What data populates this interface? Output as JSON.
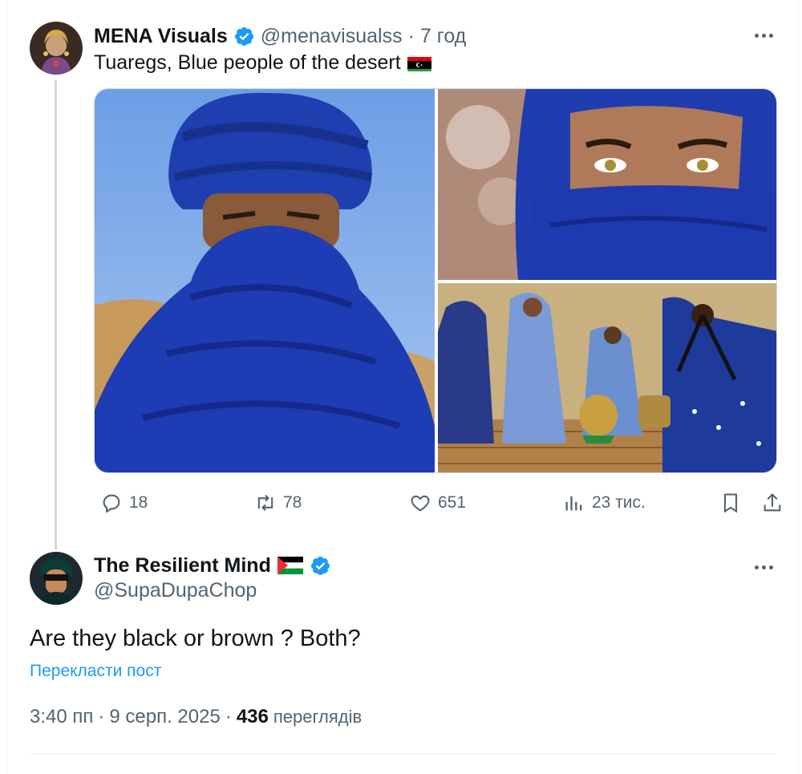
{
  "tweet1": {
    "name": "MENA Visuals",
    "handle": "@menavisualss",
    "dot": "·",
    "time": "7 год",
    "text": "Tuaregs, Blue people of the desert",
    "flag_icon": "libya-flag",
    "stats": {
      "replies": "18",
      "retweets": "78",
      "likes": "651",
      "views": "23 тис."
    }
  },
  "tweet2": {
    "name": "The Resilient Mind",
    "flag_icon": "palestine-flag",
    "handle": "@SupaDupaChop",
    "text": "Are they black or brown ? Both?",
    "translate": "Перекласти пост",
    "time": "3:40 пп",
    "sep1": "·",
    "date": "9 серп. 2025",
    "sep2": "·",
    "views_count": "436",
    "views_label": "переглядів"
  },
  "colors": {
    "verified": "#1d9bf0",
    "link": "#1d9bf0",
    "secondary_text": "#536471",
    "primary_text": "#0f1419"
  }
}
